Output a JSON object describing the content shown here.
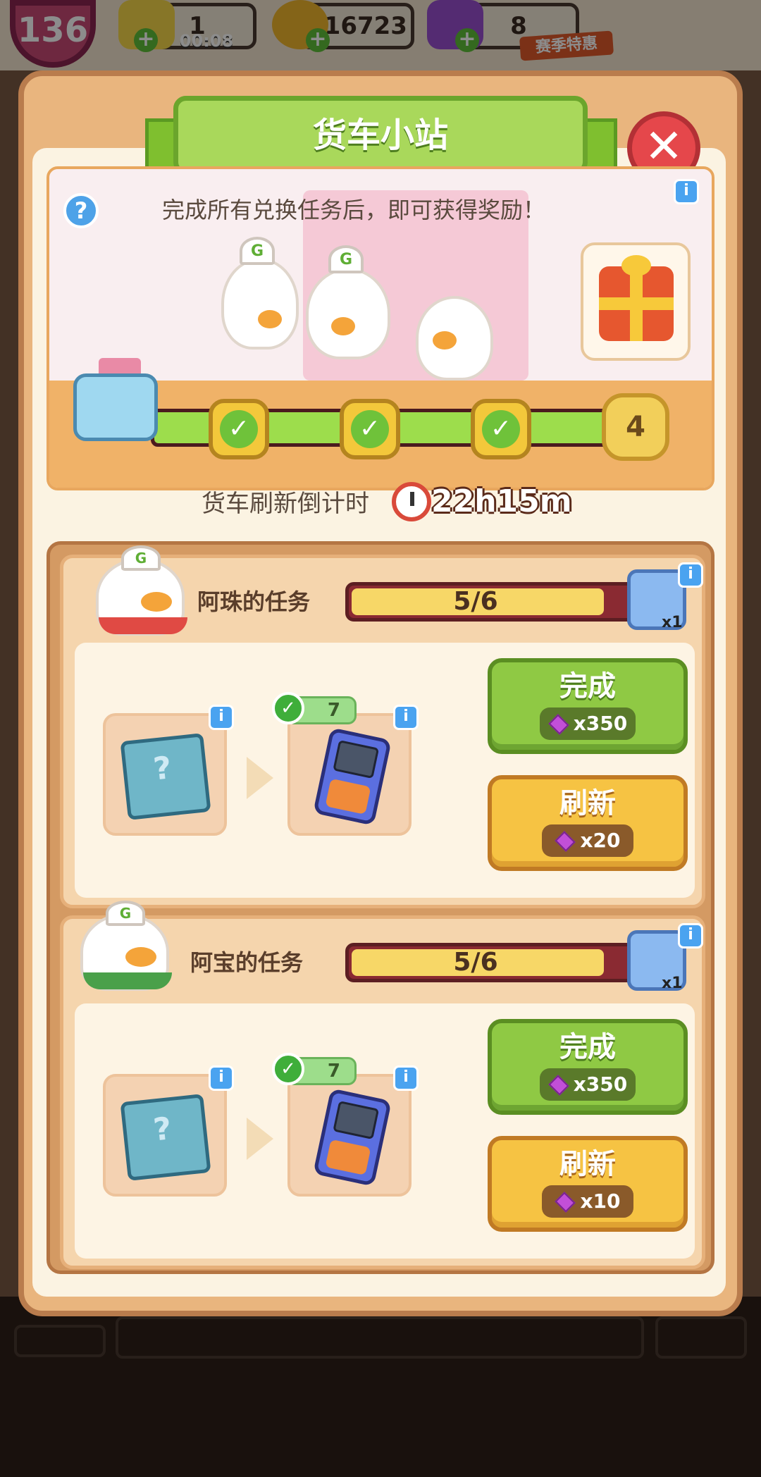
{
  "topbar": {
    "level": "136",
    "energy_value": "1",
    "energy_timer": "00:08",
    "coins": "216723",
    "gems": "8",
    "season_label": "赛季特惠"
  },
  "panel": {
    "title": "货车小站",
    "banner_text": "完成所有兑换任务后，即可获得奖励！",
    "progress_milestones_done": 3,
    "final_milestone": "4",
    "countdown_label": "货车刷新倒计时",
    "countdown_value": "22h15m"
  },
  "tasks": [
    {
      "name": "阿珠的任务",
      "progress_text": "5/6",
      "progress_fraction": 0.833,
      "reward_box_count": "x1",
      "item_count": "7",
      "complete_label": "完成",
      "complete_cost": "x350",
      "refresh_label": "刷新",
      "refresh_cost": "x20"
    },
    {
      "name": "阿宝的任务",
      "progress_text": "5/6",
      "progress_fraction": 0.833,
      "reward_box_count": "x1",
      "item_count": "7",
      "complete_label": "完成",
      "complete_cost": "x350",
      "refresh_label": "刷新",
      "refresh_cost": "x10"
    }
  ],
  "colors": {
    "panel": "#e9b57e",
    "ribbon": "#a9d85b",
    "complete_button": "#8fc944",
    "refresh_button": "#f6c343",
    "gem": "#c24fd8"
  }
}
